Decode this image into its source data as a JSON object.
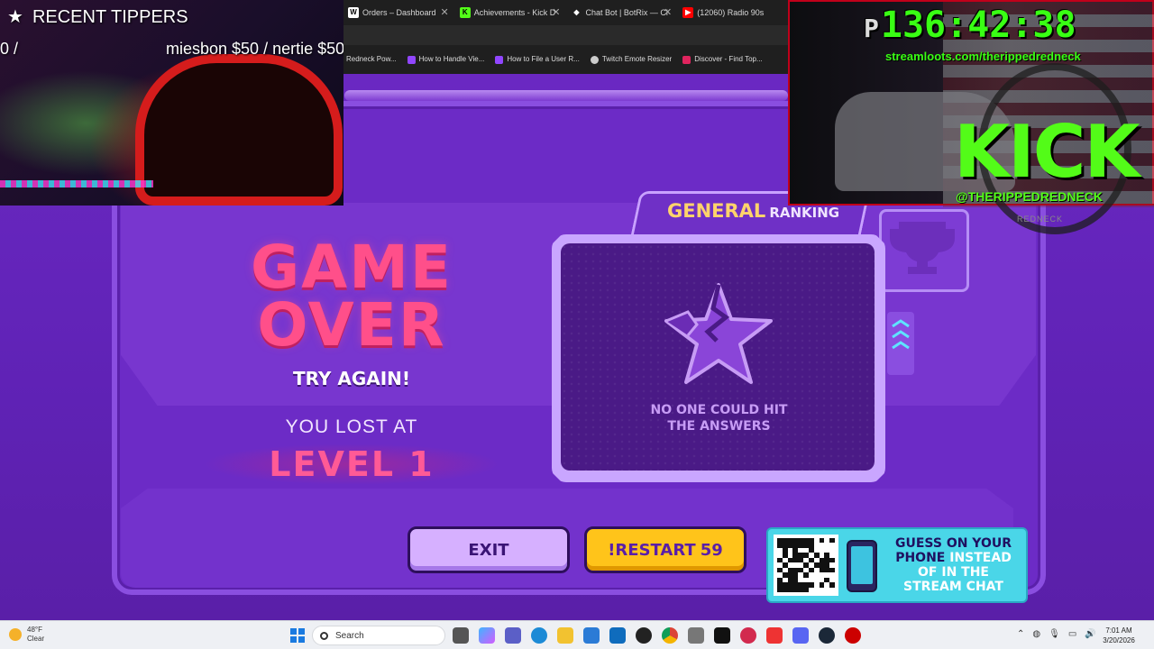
{
  "browser": {
    "tabs": [
      {
        "label": "Orders – Dashboard",
        "icon": "dashboard-favicon",
        "color": "#ffffff"
      },
      {
        "label": "Achievements - Kick D",
        "icon": "kick-favicon",
        "color": "#53fc18"
      },
      {
        "label": "Chat Bot | BotRix — Cl",
        "icon": "botrix-favicon",
        "color": "#ffffff"
      },
      {
        "label": "(12060) Radio 90s",
        "icon": "youtube-favicon",
        "color": "#ff0000"
      }
    ],
    "bookmarks": [
      {
        "label": "Redneck Pow...",
        "color": "#1f1f1f"
      },
      {
        "label": "How to Handle Vie...",
        "color": "#9146ff"
      },
      {
        "label": "How to File a User R...",
        "color": "#9146ff"
      },
      {
        "label": "Twitch Emote Resizer",
        "color": "#cccccc"
      },
      {
        "label": "Discover - Find Top...",
        "color": "#e0245e"
      }
    ]
  },
  "overlay": {
    "tippers_title": "RECENT TIPPERS",
    "tippers_left": "0 /",
    "tippers_right": "miesbon $50 / nertie $50",
    "timer_prefix": "P",
    "timer": "136:42:38",
    "streamloots_url": "streamloots.com/therippedredneck",
    "kick_logo": "KICK",
    "kick_handle": "@THERIPPEDREDNECK",
    "badge_text": "REDNECK"
  },
  "game": {
    "title_line1": "GAME",
    "title_line2": "OVER",
    "try_again": "TRY AGAIN!",
    "lost_at": "YOU LOST AT",
    "level": "LEVEL 1",
    "ranking_main": "GENERAL",
    "ranking_sub": "RANKING",
    "no_one_line1": "NO ONE COULD HIT",
    "no_one_line2": "THE ANSWERS",
    "exit_label": "EXIT",
    "restart_label": "!RESTART",
    "restart_count": "59",
    "promo_line1": "GUESS ON YOUR",
    "promo_line2a": "PHONE",
    "promo_line2b": "INSTEAD",
    "promo_line3": "OF IN THE",
    "promo_line4": "STREAM CHAT"
  },
  "taskbar": {
    "weather_temp": "48°F",
    "weather_cond": "Clear",
    "search_label": "Search",
    "time": "7:01 AM",
    "date": "3/20/2026"
  }
}
